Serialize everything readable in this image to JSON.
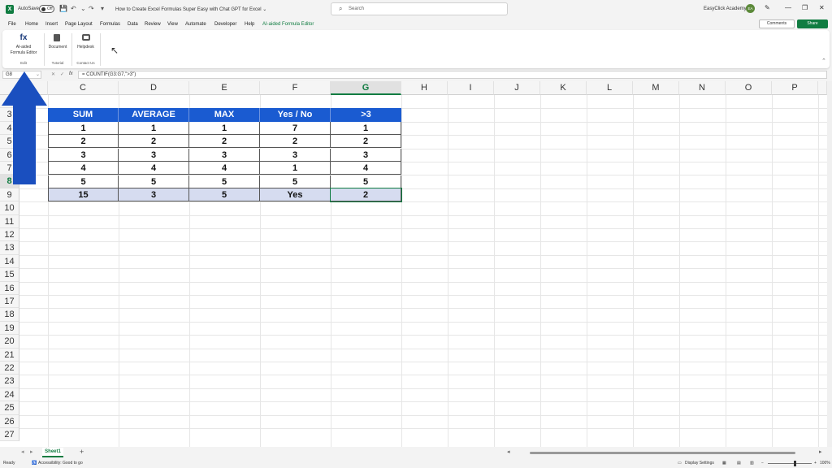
{
  "titlebar": {
    "autosave_label": "AutoSave",
    "autosave_state": "Off",
    "doc_title": "How to Create Excel Formulas Super Easy with Chat GPT for Excel ⌄",
    "search_placeholder": "Search",
    "user_name": "EasyClick Academy",
    "user_initials": "EA"
  },
  "menu": {
    "items": [
      "File",
      "Home",
      "Insert",
      "Page Layout",
      "Formulas",
      "Data",
      "Review",
      "View",
      "Automate",
      "Developer",
      "Help",
      "AI-aided Formula Editor"
    ],
    "comments": "Comments",
    "share": "Share"
  },
  "ribbon": {
    "ai_editor": "AI-aided\nFormula Editor",
    "ai_editor_l1": "AI-aided",
    "ai_editor_l2": "Formula Editor",
    "group_edit": "Edit",
    "document": "Document",
    "group_tutorial": "Tutorial",
    "helpdesk": "Helpdesk",
    "group_contact": "Contact Us"
  },
  "formula_bar": {
    "name_box": "G8",
    "fx": "fx",
    "formula": "= COUNTIF(G3:G7,\">3\")"
  },
  "grid": {
    "columns": [
      "C",
      "D",
      "E",
      "F",
      "G",
      "H",
      "I",
      "J",
      "K",
      "L",
      "M",
      "N",
      "O",
      "P"
    ],
    "rows": [
      "2",
      "3",
      "4",
      "5",
      "6",
      "7",
      "8",
      "9",
      "10",
      "11",
      "12",
      "13",
      "14",
      "15",
      "16",
      "17",
      "18",
      "19",
      "20",
      "21",
      "22",
      "23",
      "24",
      "25",
      "26",
      "27"
    ],
    "selected_column": "G",
    "selected_row": "8"
  },
  "table": {
    "headers": [
      "SUM",
      "AVERAGE",
      "MAX",
      "Yes / No",
      ">3"
    ],
    "rows": [
      [
        "1",
        "1",
        "1",
        "7",
        "1"
      ],
      [
        "2",
        "2",
        "2",
        "2",
        "2"
      ],
      [
        "3",
        "3",
        "3",
        "3",
        "3"
      ],
      [
        "4",
        "4",
        "4",
        "1",
        "4"
      ],
      [
        "5",
        "5",
        "5",
        "5",
        "5"
      ]
    ],
    "totals": [
      "15",
      "3",
      "5",
      "Yes",
      "2"
    ]
  },
  "sheet_tabs": {
    "active": "Sheet1",
    "add": "+"
  },
  "status": {
    "ready": "Ready",
    "accessibility": "Accessibility: Good to go",
    "display_settings": "Display Settings",
    "zoom": "100%"
  },
  "colors": {
    "accent": "#107c41",
    "table_header": "#1a5bd1",
    "total_row": "#d6dcf0",
    "arrow": "#1a4fbf"
  }
}
